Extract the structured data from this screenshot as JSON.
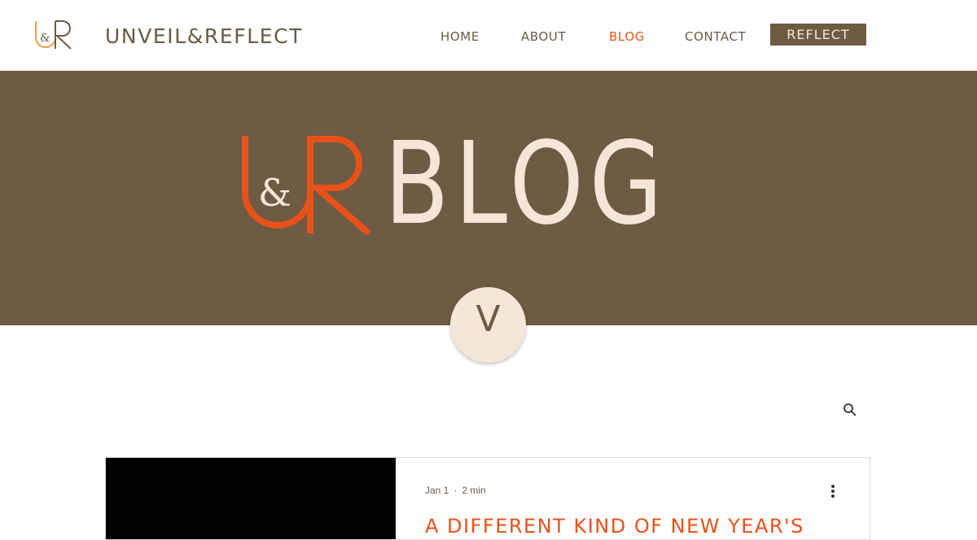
{
  "header": {
    "site_name": "UNVEIL&REFLECT",
    "logo_letters": {
      "left": "U",
      "middle": "&",
      "right": "R"
    }
  },
  "nav": {
    "items": [
      {
        "label": "HOME",
        "active": false
      },
      {
        "label": "ABOUT",
        "active": false
      },
      {
        "label": "BLOG",
        "active": true
      },
      {
        "label": "CONTACT",
        "active": false
      }
    ],
    "cta_label": "REFLECT"
  },
  "hero": {
    "logo_letters": {
      "left": "U",
      "middle": "&",
      "right": "R"
    },
    "title": "BLOG",
    "avatar_initial": "V"
  },
  "colors": {
    "brand_brown": "#6d5b43",
    "accent_orange": "#e8521a",
    "cream": "#f6e6d8"
  },
  "icons": {
    "search": "search-icon",
    "more": "more-vertical-icon"
  },
  "post": {
    "date": "Jan 1",
    "read_time": "2 min",
    "title": "A DIFFERENT KIND OF NEW YEAR'S"
  }
}
